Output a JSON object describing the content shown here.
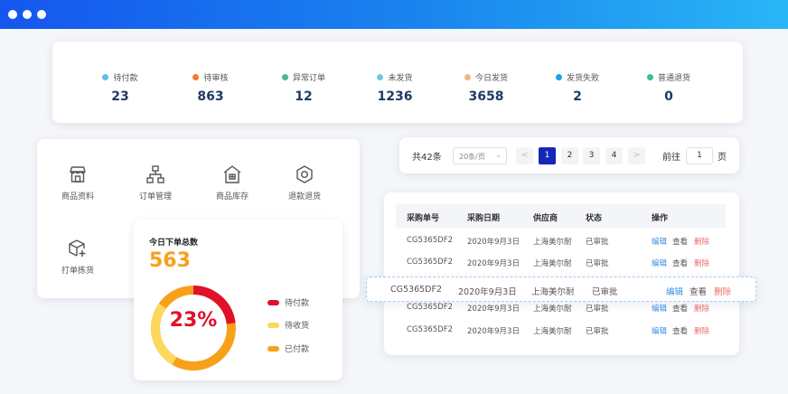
{
  "colors": {
    "titlebar_start": "#1556ee",
    "titlebar_end": "#29b6f6",
    "accent": "#1428b8",
    "count": "#f7a11b",
    "donut_red": "#e0112b",
    "donut_yellow": "#fcd85e",
    "donut_orange": "#f7a11b"
  },
  "stats": [
    {
      "label": "待付款",
      "value": "23",
      "color": "#5bc0eb"
    },
    {
      "label": "待审核",
      "value": "863",
      "color": "#f6792d"
    },
    {
      "label": "异常订单",
      "value": "12",
      "color": "#52b788"
    },
    {
      "label": "未发货",
      "value": "1236",
      "color": "#6ec6e0"
    },
    {
      "label": "今日发货",
      "value": "3658",
      "color": "#e8b98f"
    },
    {
      "label": "发货失败",
      "value": "2",
      "color": "#1aa1e6"
    },
    {
      "label": "普通退货",
      "value": "0",
      "color": "#3cbf85"
    }
  ],
  "menu": [
    {
      "label": "商品资料",
      "icon": "shop-icon"
    },
    {
      "label": "订单管理",
      "icon": "hierarchy-icon"
    },
    {
      "label": "商品库存",
      "icon": "warehouse-icon"
    },
    {
      "label": "退款退货",
      "icon": "settings-hex-icon"
    },
    {
      "label": "打单拣货",
      "icon": "package-add-icon"
    }
  ],
  "orders": {
    "title": "今日下单总数",
    "count": "563",
    "percent": "23%",
    "donut_fraction": 0.23,
    "legend": [
      {
        "label": "待付款",
        "color": "#e0112b"
      },
      {
        "label": "待收货",
        "color": "#fcd85e"
      },
      {
        "label": "已付款",
        "color": "#f7a11b"
      }
    ]
  },
  "pagination": {
    "total": "共42条",
    "page_size": "20条/页",
    "pages": [
      "1",
      "2",
      "3",
      "4"
    ],
    "current": "1",
    "prev": "<",
    "next": ">",
    "goto_prefix": "前往",
    "goto_value": "1",
    "goto_suffix": "页"
  },
  "table": {
    "headers": [
      "采购单号",
      "采购日期",
      "供应商",
      "状态",
      "操作"
    ],
    "rows": [
      {
        "id": "CG5365DF2",
        "date": "2020年9月3日",
        "supplier": "上海美尔耐",
        "status": "已审批"
      },
      {
        "id": "CG5365DF2",
        "date": "2020年9月3日",
        "supplier": "上海美尔耐",
        "status": "已审批"
      },
      {
        "id": "CG5365DF2",
        "date": "2020年9月3日",
        "supplier": "上海美尔耐",
        "status": "已审批"
      },
      {
        "id": "CG5365DF2",
        "date": "2020年9月3日",
        "supplier": "上海美尔耐",
        "status": "已审批"
      }
    ],
    "floating_row": {
      "id": "CG5365DF2",
      "date": "2020年9月3日",
      "supplier": "上海美尔耐",
      "status": "已审批"
    },
    "actions": {
      "edit": "编辑",
      "view": "查看",
      "delete": "删除"
    }
  }
}
